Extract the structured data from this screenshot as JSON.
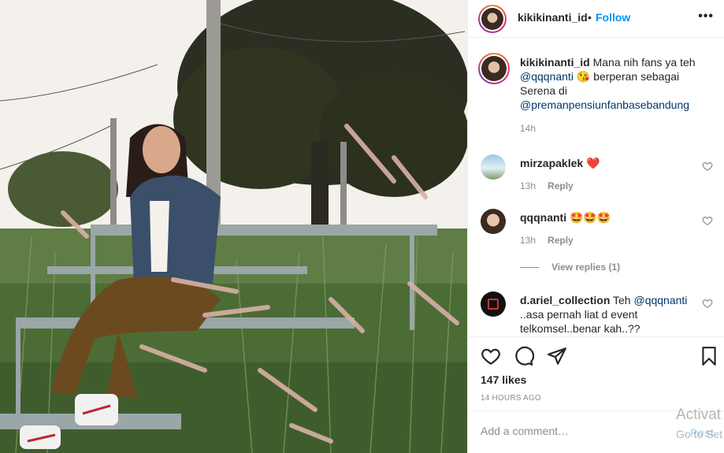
{
  "header": {
    "username": "kikikinanti_id",
    "separator": "•",
    "follow_label": "Follow",
    "more_icon": "more-options-icon"
  },
  "caption": {
    "username": "kikikinanti_id",
    "text_1": "Mana nih fans ya teh",
    "mention_1": "@qqqnanti",
    "emoji_1": "😘",
    "text_2": "berperan sebagai Serena di",
    "mention_2": "@premanpensiunfanbasebandung",
    "time": "14h"
  },
  "comments": [
    {
      "username": "mirzapaklek",
      "text": "❤️",
      "time": "13h",
      "reply_label": "Reply"
    },
    {
      "username": "qqqnanti",
      "text": "🤩🤩🤩",
      "time": "13h",
      "reply_label": "Reply"
    },
    {
      "username": "d.ariel_collection",
      "text_1": "Teh",
      "mention": "@qqqnanti",
      "text_2": "..asa pernah liat d event telkomsel..benar kah..??"
    }
  ],
  "view_replies_label": "View replies (1)",
  "actions": {
    "likes": "147 likes",
    "posted": "14 HOURS AGO",
    "comment_placeholder": "Add a comment…",
    "post_label": "Post"
  },
  "watermark": {
    "line1": "Activat",
    "line2": "Go to Set"
  },
  "colors": {
    "link": "#00376b",
    "follow": "#0095f6",
    "secondary": "#8e8e8e",
    "heart_red": "#ed4956"
  }
}
